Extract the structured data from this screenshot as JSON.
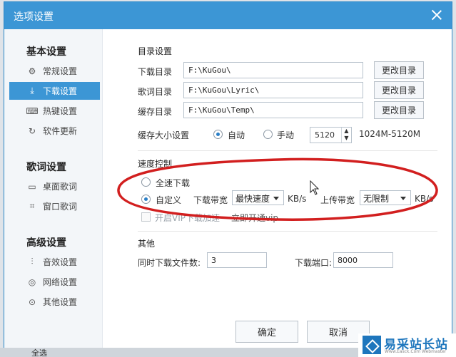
{
  "dialog": {
    "title": "选项设置"
  },
  "sidebar": {
    "groups": [
      {
        "title": "基本设置",
        "items": [
          {
            "label": "常规设置",
            "icon": "gear-icon"
          },
          {
            "label": "下载设置",
            "icon": "download-icon",
            "active": true
          },
          {
            "label": "热键设置",
            "icon": "keyboard-icon"
          },
          {
            "label": "软件更新",
            "icon": "refresh-icon"
          }
        ]
      },
      {
        "title": "歌词设置",
        "items": [
          {
            "label": "桌面歌词",
            "icon": "desktop-lyrics-icon"
          },
          {
            "label": "窗口歌词",
            "icon": "window-lyrics-icon"
          }
        ]
      },
      {
        "title": "高级设置",
        "items": [
          {
            "label": "音效设置",
            "icon": "equalizer-icon"
          },
          {
            "label": "网络设置",
            "icon": "globe-icon"
          },
          {
            "label": "其他设置",
            "icon": "more-icon"
          }
        ]
      }
    ]
  },
  "directory": {
    "section_title": "目录设置",
    "rows": [
      {
        "label": "下载目录",
        "path": "F:\\KuGou\\",
        "button": "更改目录"
      },
      {
        "label": "歌词目录",
        "path": "F:\\KuGou\\Lyric\\",
        "button": "更改目录"
      },
      {
        "label": "缓存目录",
        "path": "F:\\KuGou\\Temp\\",
        "button": "更改目录"
      }
    ],
    "cache_size_label": "缓存大小设置",
    "cache_auto": "自动",
    "cache_manual": "手动",
    "cache_value": "5120",
    "cache_range": "1024M-5120M"
  },
  "speed": {
    "section_title": "速度控制",
    "full_speed": "全速下载",
    "custom": "自定义",
    "download_bw_label": "下载带宽",
    "download_bw_value": "最快速度",
    "unit_kbs": "KB/s",
    "upload_bw_label": "上传带宽",
    "upload_bw_value": "无限制",
    "vip_check_label": "开启VIP下载加速",
    "vip_link": "立即开通vip"
  },
  "other": {
    "section_title": "其他",
    "concurrent_label": "同时下载文件数:",
    "concurrent_value": "3",
    "port_label": "下载端口:",
    "port_value": "8000"
  },
  "footer": {
    "ok": "确定",
    "cancel": "取消"
  },
  "bottom_strip": {
    "text": "全选"
  },
  "watermark": {
    "name": "易采站长站",
    "url": "Www.Easck.Com Webmaster"
  },
  "colors": {
    "title_bar": "#3c96d5",
    "accent": "#2a7fc7",
    "annotation": "#d21f1f",
    "watermark_blue": "#1e76bd"
  }
}
